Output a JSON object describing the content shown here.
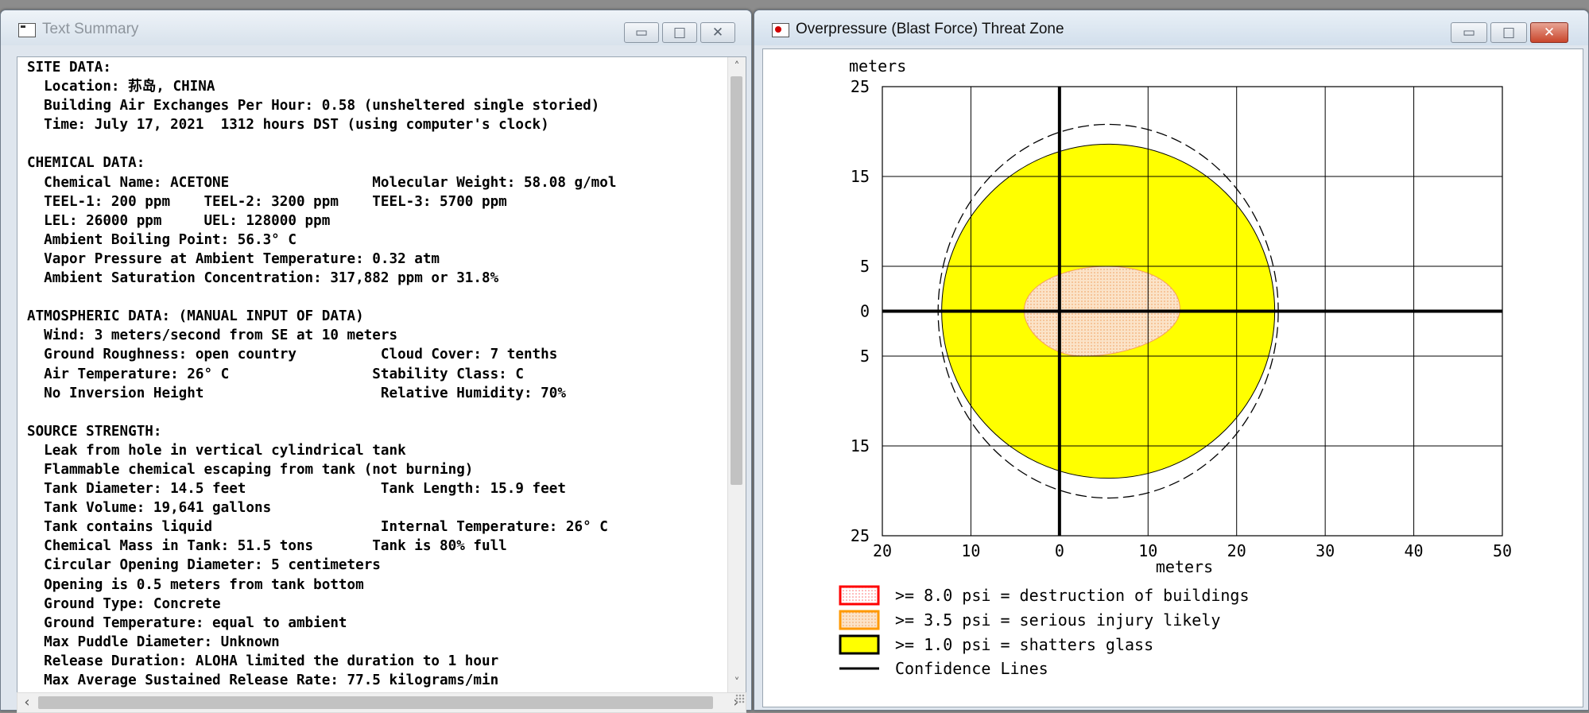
{
  "summary_window": {
    "title": "Text Summary",
    "buttons": {
      "minimize": "▭",
      "maximize": "□",
      "close": "✕"
    },
    "lines": [
      "SITE DATA:",
      "  Location: 荪岛, CHINA",
      "  Building Air Exchanges Per Hour: 0.58 (unsheltered single storied)",
      "  Time: July 17, 2021  1312 hours DST (using computer's clock)",
      "",
      "CHEMICAL DATA:",
      "  Chemical Name: ACETONE                 Molecular Weight: 58.08 g/mol",
      "  TEEL-1: 200 ppm    TEEL-2: 3200 ppm    TEEL-3: 5700 ppm",
      "  LEL: 26000 ppm     UEL: 128000 ppm",
      "  Ambient Boiling Point: 56.3° C",
      "  Vapor Pressure at Ambient Temperature: 0.32 atm",
      "  Ambient Saturation Concentration: 317,882 ppm or 31.8%",
      "",
      "ATMOSPHERIC DATA: (MANUAL INPUT OF DATA)",
      "  Wind: 3 meters/second from SE at 10 meters",
      "  Ground Roughness: open country          Cloud Cover: 7 tenths",
      "  Air Temperature: 26° C                 Stability Class: C",
      "  No Inversion Height                     Relative Humidity: 70%",
      "",
      "SOURCE STRENGTH:",
      "  Leak from hole in vertical cylindrical tank",
      "  Flammable chemical escaping from tank (not burning)",
      "  Tank Diameter: 14.5 feet                Tank Length: 15.9 feet",
      "  Tank Volume: 19,641 gallons",
      "  Tank contains liquid                    Internal Temperature: 26° C",
      "  Chemical Mass in Tank: 51.5 tons       Tank is 80% full",
      "  Circular Opening Diameter: 5 centimeters",
      "  Opening is 0.5 meters from tank bottom",
      "  Ground Type: Concrete",
      "  Ground Temperature: equal to ambient",
      "  Max Puddle Diameter: Unknown",
      "  Release Duration: ALOHA limited the duration to 1 hour",
      "  Max Average Sustained Release Rate: 77.5 kilograms/min"
    ],
    "scroll": {
      "up": "˄",
      "down": "˅",
      "left": "‹",
      "right": "›"
    }
  },
  "threat_window": {
    "title": "Overpressure (Blast Force) Threat Zone",
    "buttons": {
      "minimize": "▭",
      "maximize": "□",
      "close": "✕"
    }
  },
  "chart_data": {
    "type": "threat-zone-plot",
    "xlabel": "meters",
    "ylabel": "meters",
    "xlim": [
      -20,
      50
    ],
    "ylim": [
      -25,
      25
    ],
    "x_ticks": [
      -20,
      -10,
      0,
      10,
      20,
      30,
      40,
      50
    ],
    "x_tick_labels": [
      "20",
      "10",
      "0",
      "10",
      "20",
      "30",
      "40",
      "50"
    ],
    "y_ticks": [
      25,
      15,
      5,
      0,
      -5,
      -15,
      -25
    ],
    "y_tick_labels": [
      "25",
      "15",
      "5",
      "0",
      "5",
      "15",
      "25"
    ],
    "grid": true,
    "zones": [
      {
        "name": "zone-1psi",
        "label": ">= 1.0 psi = shatters glass",
        "fill": "#ffff00",
        "stroke": "#000000",
        "cx": 5.5,
        "cy": 0,
        "rx": 18.8,
        "ry": 18.6
      },
      {
        "name": "zone-3-5psi",
        "label": ">= 3.5 psi = serious injury likely",
        "fill": "#fbe3c8",
        "stroke": "#f5a05a",
        "cx": 4.8,
        "cy": 0,
        "rx": 8.8,
        "ry": 5
      },
      {
        "name": "zone-8psi",
        "label": ">= 8.0 psi = destruction of buildings",
        "fill": "#ffffff",
        "stroke": "#ff0000"
      }
    ],
    "confidence_line": {
      "label": "Confidence Lines",
      "cx": 5.5,
      "cy": 0,
      "rx": 19.2,
      "ry": 20.8
    },
    "legend": [
      {
        "label": ">= 8.0 psi = destruction of buildings",
        "fill": "#ffffff",
        "stroke": "#ff0000",
        "pattern": true
      },
      {
        "label": ">= 3.5 psi = serious injury likely",
        "fill": "#fbe3c8",
        "stroke": "#ff9900",
        "pattern": true
      },
      {
        "label": ">= 1.0 psi = shatters glass",
        "fill": "#ffff00",
        "stroke": "#000000",
        "pattern": false
      },
      {
        "label": "Confidence Lines",
        "line": true
      }
    ]
  }
}
